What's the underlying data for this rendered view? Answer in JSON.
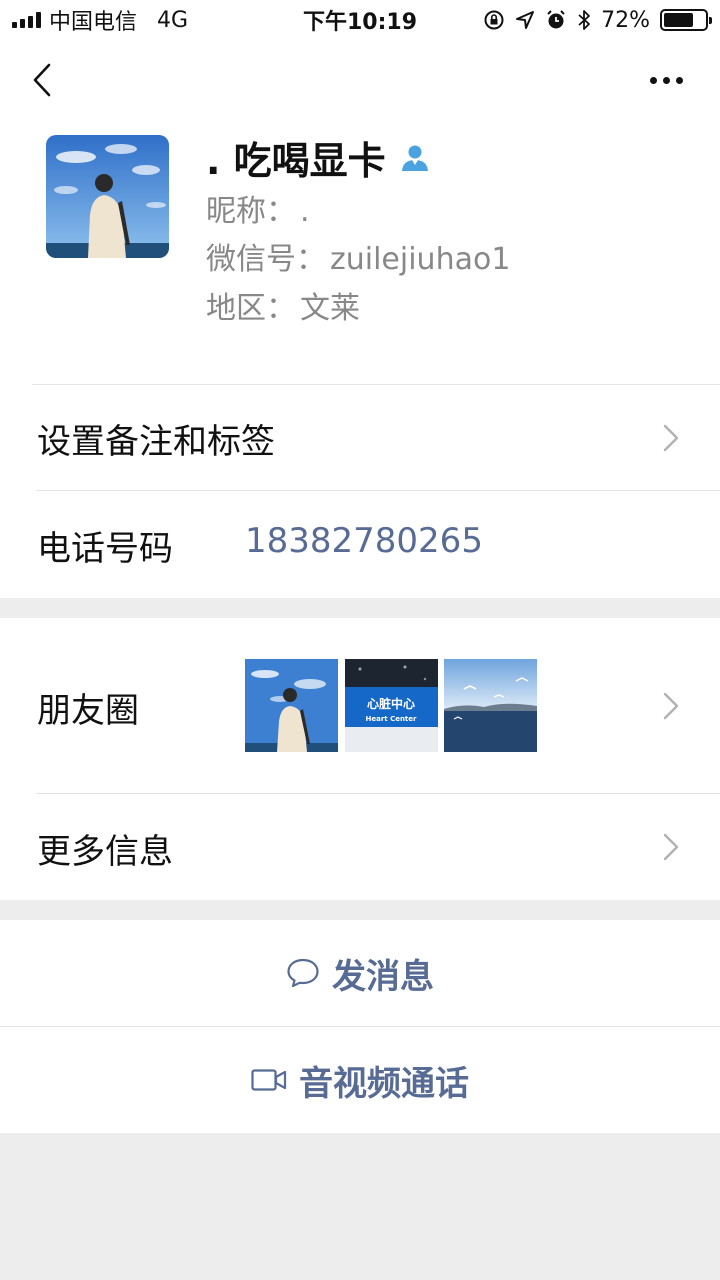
{
  "status_bar": {
    "carrier": "中国电信",
    "network": "4G",
    "time": "下午10:19",
    "battery_percent": "72%",
    "battery_level": 0.72,
    "icons": [
      "signal-icon",
      "orientation-lock-icon",
      "location-arrow-icon",
      "alarm-icon",
      "bluetooth-icon",
      "battery-icon"
    ]
  },
  "nav": {
    "back_icon": "chevron-left-icon",
    "more_icon": "more-dots-icon"
  },
  "profile": {
    "display_name": ". 吃喝显卡",
    "nickname_label": "昵称：",
    "nickname_value": ".",
    "wechat_id_label": "微信号：",
    "wechat_id_value": "zuilejiuhao1",
    "region_label": "地区：",
    "region_value": "文莱",
    "gender_icon": "male-user-icon"
  },
  "rows": {
    "remark_label": "设置备注和标签",
    "phone_label": "电话号码",
    "phone_value": "18382780265",
    "moments_label": "朋友圈",
    "moments_thumb_sign_cn": "心脏中心",
    "moments_thumb_sign_en": "Heart Center",
    "more_info_label": "更多信息"
  },
  "actions": {
    "message_label": "发消息",
    "message_icon": "chat-bubble-icon",
    "call_label": "音视频通话",
    "call_icon": "video-camera-icon"
  },
  "colors": {
    "link_blue": "#576b95",
    "page_bg": "#ededed",
    "user_icon_blue": "#4aa3df"
  }
}
